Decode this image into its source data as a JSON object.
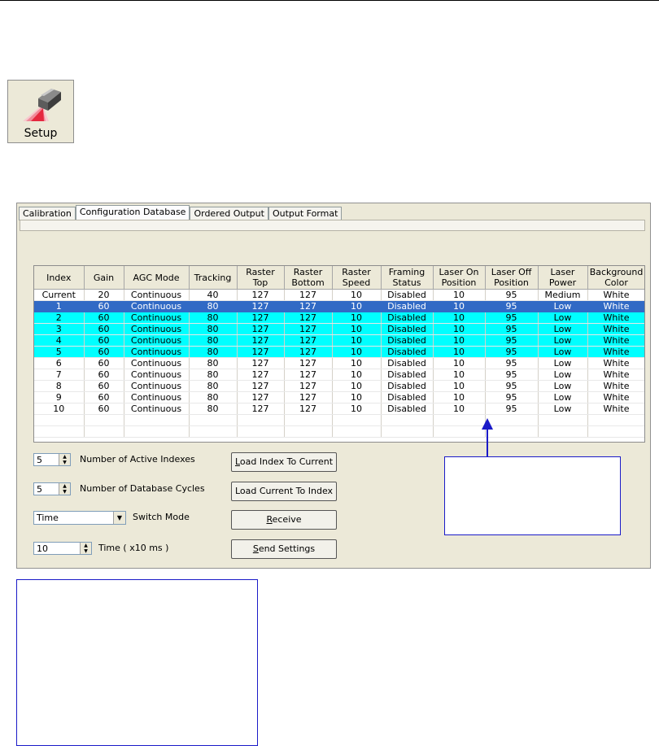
{
  "setup_button": {
    "label": "Setup"
  },
  "tabs": [
    {
      "label": "Calibration",
      "active": false
    },
    {
      "label": "Configuration Database",
      "active": true
    },
    {
      "label": "Ordered Output",
      "active": false
    },
    {
      "label": "Output Format",
      "active": false
    }
  ],
  "table": {
    "headers": [
      [
        "Index"
      ],
      [
        "Gain"
      ],
      [
        "AGC Mode"
      ],
      [
        "Tracking"
      ],
      [
        "Raster",
        "Top"
      ],
      [
        "Raster",
        "Bottom"
      ],
      [
        "Raster",
        "Speed"
      ],
      [
        "Framing",
        "Status"
      ],
      [
        "Laser On",
        "Position"
      ],
      [
        "Laser Off",
        "Position"
      ],
      [
        "Laser",
        "Power"
      ],
      [
        "Background",
        "Color"
      ]
    ],
    "rows": [
      [
        "Current",
        "20",
        "Continuous",
        "40",
        "127",
        "127",
        "10",
        "Disabled",
        "10",
        "95",
        "Medium",
        "White"
      ],
      [
        "1",
        "60",
        "Continuous",
        "80",
        "127",
        "127",
        "10",
        "Disabled",
        "10",
        "95",
        "Low",
        "White"
      ],
      [
        "2",
        "60",
        "Continuous",
        "80",
        "127",
        "127",
        "10",
        "Disabled",
        "10",
        "95",
        "Low",
        "White"
      ],
      [
        "3",
        "60",
        "Continuous",
        "80",
        "127",
        "127",
        "10",
        "Disabled",
        "10",
        "95",
        "Low",
        "White"
      ],
      [
        "4",
        "60",
        "Continuous",
        "80",
        "127",
        "127",
        "10",
        "Disabled",
        "10",
        "95",
        "Low",
        "White"
      ],
      [
        "5",
        "60",
        "Continuous",
        "80",
        "127",
        "127",
        "10",
        "Disabled",
        "10",
        "95",
        "Low",
        "White"
      ],
      [
        "6",
        "60",
        "Continuous",
        "80",
        "127",
        "127",
        "10",
        "Disabled",
        "10",
        "95",
        "Low",
        "White"
      ],
      [
        "7",
        "60",
        "Continuous",
        "80",
        "127",
        "127",
        "10",
        "Disabled",
        "10",
        "95",
        "Low",
        "White"
      ],
      [
        "8",
        "60",
        "Continuous",
        "80",
        "127",
        "127",
        "10",
        "Disabled",
        "10",
        "95",
        "Low",
        "White"
      ],
      [
        "9",
        "60",
        "Continuous",
        "80",
        "127",
        "127",
        "10",
        "Disabled",
        "10",
        "95",
        "Low",
        "White"
      ],
      [
        "10",
        "60",
        "Continuous",
        "80",
        "127",
        "127",
        "10",
        "Disabled",
        "10",
        "95",
        "Low",
        "White"
      ],
      [
        "",
        "",
        "",
        "",
        "",
        "",
        "",
        "",
        "",
        "",
        "",
        ""
      ],
      [
        "",
        "",
        "",
        "",
        "",
        "",
        "",
        "",
        "",
        "",
        "",
        ""
      ]
    ],
    "selected_row": 1,
    "highlighted_rows": [
      2,
      3,
      4,
      5
    ]
  },
  "controls": {
    "active_indexes": {
      "value": "5",
      "label": "Number of Active Indexes"
    },
    "database_cycles": {
      "value": "5",
      "label": "Number of Database Cycles"
    },
    "switch_mode": {
      "value": "Time",
      "label": "Switch Mode"
    },
    "time": {
      "value": "10",
      "label": "Time ( x10 ms )"
    }
  },
  "buttons": {
    "load_index_prefix": "L",
    "load_index_rest": "oad Index To Current",
    "load_current": "Load Current To Index",
    "receive_prefix": "R",
    "receive_rest": "eceive",
    "send_prefix": "S",
    "send_rest": "end Settings"
  },
  "colors": {
    "selected_row": "#316ac5",
    "highlighted_row": "#00ffff",
    "callout_border": "#1a1ac8"
  }
}
